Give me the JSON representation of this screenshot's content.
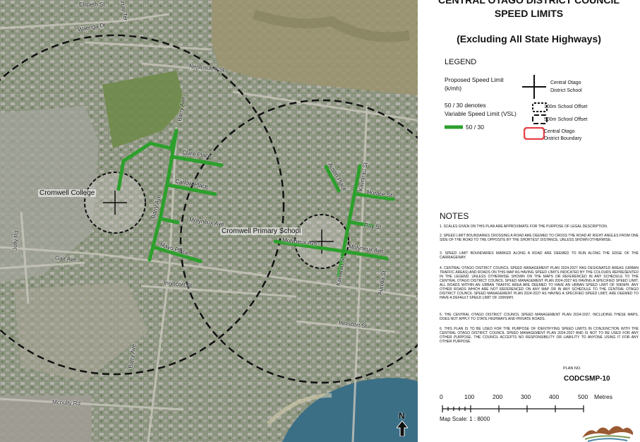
{
  "map": {
    "school_labels": {
      "college": "Cromwell College",
      "primary": "Cromwell Primary School"
    },
    "streets": {
      "elspeth": "Elspeth St",
      "waenga": "Waenga Dr",
      "neplusultra": "Neplusultra St",
      "barry_top": "Barry Ave",
      "clare": "Clare Place",
      "carlow": "Carlow Place",
      "barry_mid": "Barry Ave",
      "molyneux_top": "Molyneux Ave",
      "molyneux_mid": "Molyneux Ave",
      "molyneux_right": "Molyneux Ave",
      "mayo": "Mayo Place",
      "gair": "Gair Ave",
      "inniscort_left": "Inniscort St",
      "inniscort_right": "Inniscort St",
      "jolly": "Jolly Rd",
      "barry_bottom": "Barry Ave",
      "mcnulty": "Mcnulty Rd",
      "austin": "Austin Place",
      "horace": "Horace St",
      "kawarau": "Kawarau St",
      "kawarau_bottom": "Kawarau St",
      "ray": "Ray St",
      "aurelia": "Aurelia St",
      "murray": "Murray Ter"
    },
    "north_label": "N",
    "colors": {
      "speed_zone": "#2ca02c",
      "circle": "#111111"
    }
  },
  "panel": {
    "title_line1": "CENTRAL OTAGO DISTRICT COUNCIL",
    "title_line2": "SPEED LIMITS",
    "subtitle": "(Excluding All State Highways)",
    "legend": {
      "title": "LEGEND",
      "proposed_line1": "Proposed Speed Limit",
      "proposed_line2": "(k/mh)",
      "vsl_line1": "50 / 30 denotes",
      "vsl_line2": "Variable Speed Limit (VSL)",
      "vsl_value": "50 / 30",
      "school_line1": "Central Otago",
      "school_line2": "District School",
      "offset100": "100m School Offset",
      "offset500": "500m School Offset",
      "boundary_line1": "Central Otago",
      "boundary_line2": "District Boundary",
      "boundary_color": "#e8434a"
    },
    "notes_title": "NOTES",
    "notes": [
      "1. Scales given on this plan are approximate for the purpose of legal description.",
      "2. Speed limit boundaries crossing a road are deemed to cross the road at right angles from one side of the road to the opposite by the shortest distance, unless shown otherwise.",
      "3. Speed limit boundaries marked along a road are deemed to run along the edge of the carriageway.",
      "4. Central Otago District Council Speed Management Plan 2024-2027 has designated areas (urban traffic areas) and roads on this map as having speed limits indicated by the colours represented in the legend. Unless otherwise shown on the maps or referenced in any schedule to the Central Otago District Council Speed Management Plan 2024-2027 as having a specified speed limit, all roads within an urban traffic area are deemed to have an urban speed limit of 50km/h. Any other roads which are not referenced on any map or in any schedule to the Central Otago District Council Speed Management Plan 2024-2027 as having a specified speed limit, are deemed to have a default speed limit of 100km/h.",
      "5. The Central Otago District Council Speed Management Plan 2024-2027, including these maps, does not apply to State Highways and private roads.",
      "6. This plan is to be used for the purpose of identifying speed limits in conjunction with the Central Otago District Council Speed Management Plan 2024-2027 and is not to be used for any other purpose. The Council accepts no responsibility or liability to anyone using it for any other purpose."
    ],
    "plan_no_label": "PLAN NO.",
    "plan_no": "CODCSMP-10",
    "scale_ticks": [
      "0",
      "100",
      "200",
      "300",
      "400",
      "500"
    ],
    "scale_unit": "Metres",
    "map_scale": "Map Scale: 1 : 8000"
  }
}
